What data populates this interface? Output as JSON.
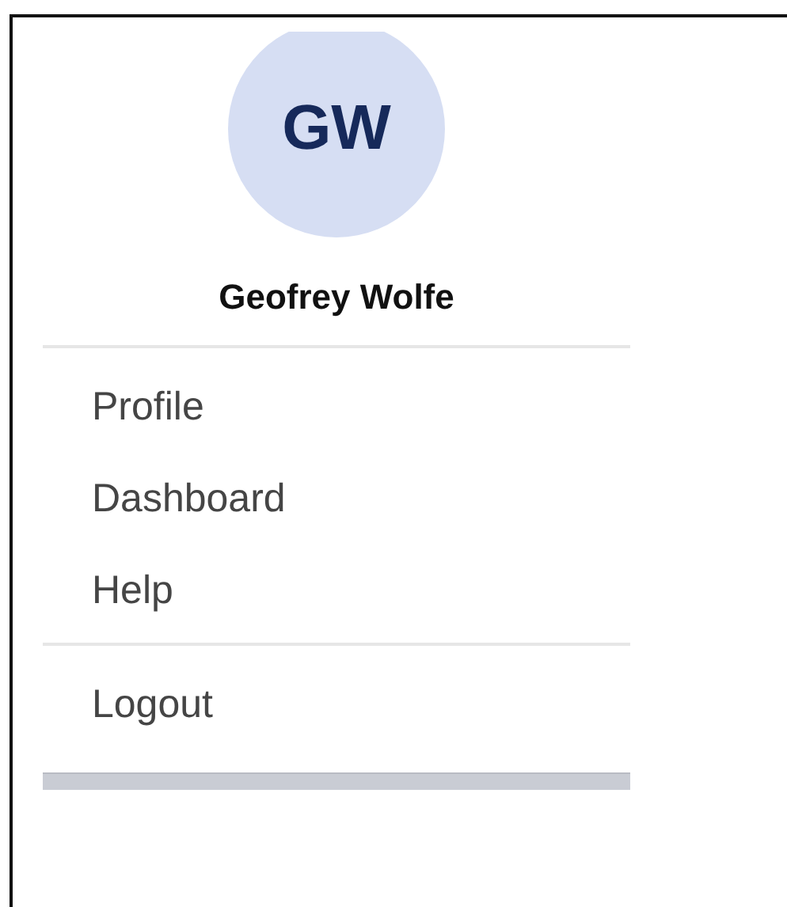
{
  "user": {
    "initials": "GW",
    "name": "Geofrey Wolfe"
  },
  "sections": [
    {
      "items": [
        {
          "label": "Profile"
        },
        {
          "label": "Dashboard"
        },
        {
          "label": "Help"
        }
      ]
    },
    {
      "items": [
        {
          "label": "Logout"
        }
      ]
    }
  ]
}
